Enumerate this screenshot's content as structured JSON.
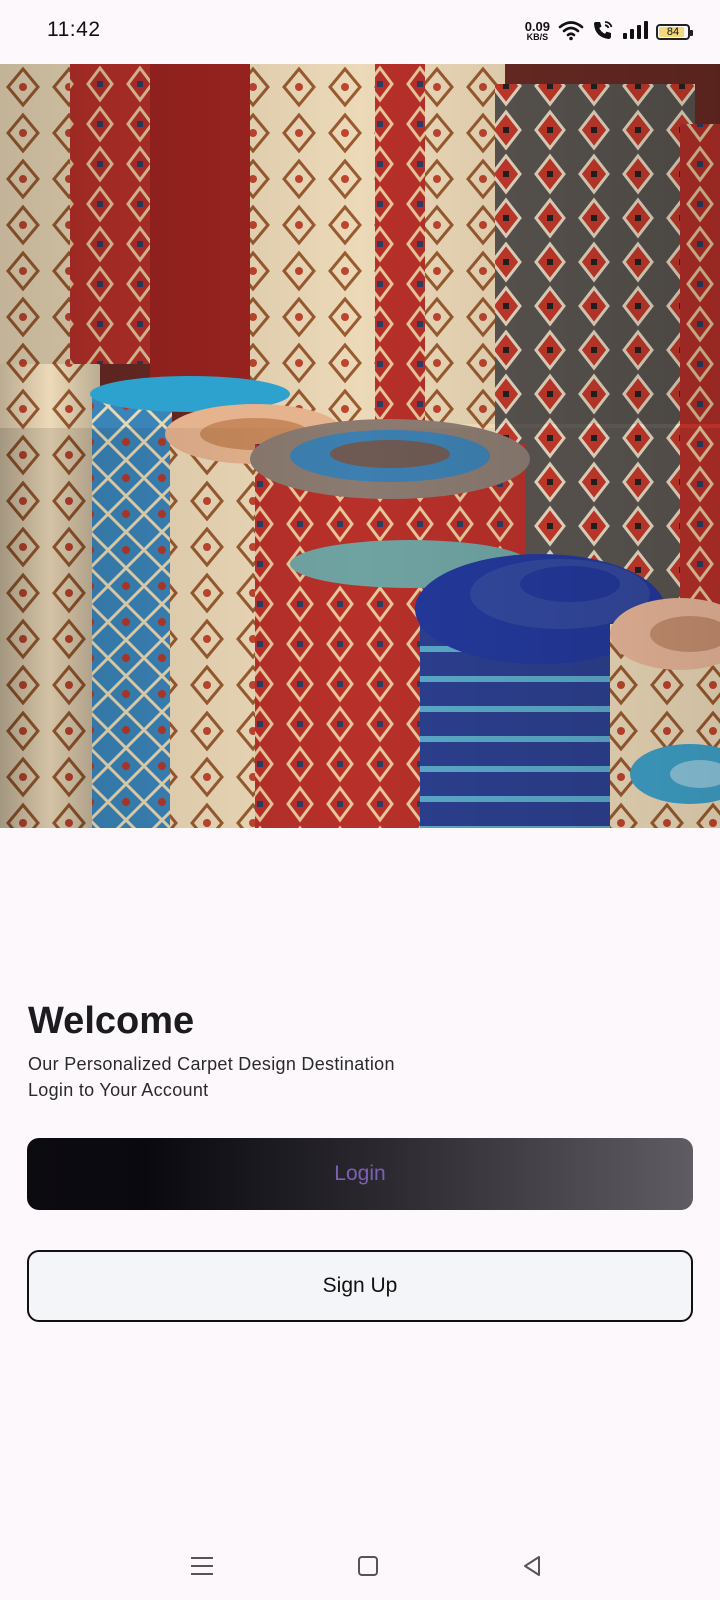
{
  "status_bar": {
    "time": "11:42",
    "net_speed": "0.09",
    "net_unit": "KB/S",
    "battery_level": "84",
    "battery_fraction": 0.84,
    "icons": [
      "wifi-icon",
      "wifi-call-icon",
      "signal-icon",
      "battery-icon"
    ]
  },
  "hero": {
    "image_description_icon": "carpet-rolls-photo"
  },
  "welcome": {
    "title": "Welcome",
    "subtitle_1": "Our Personalized Carpet Design Destination",
    "subtitle_2": "Login to Your Account"
  },
  "buttons": {
    "login_label": "Login",
    "signup_label": "Sign Up"
  },
  "nav_bar": {
    "icons": [
      "menu-icon",
      "home-square-icon",
      "back-triangle-icon"
    ]
  },
  "colors": {
    "background": "#fdf8fc",
    "login_text": "#7e5fb8",
    "battery_fill": "#f3d87c"
  }
}
